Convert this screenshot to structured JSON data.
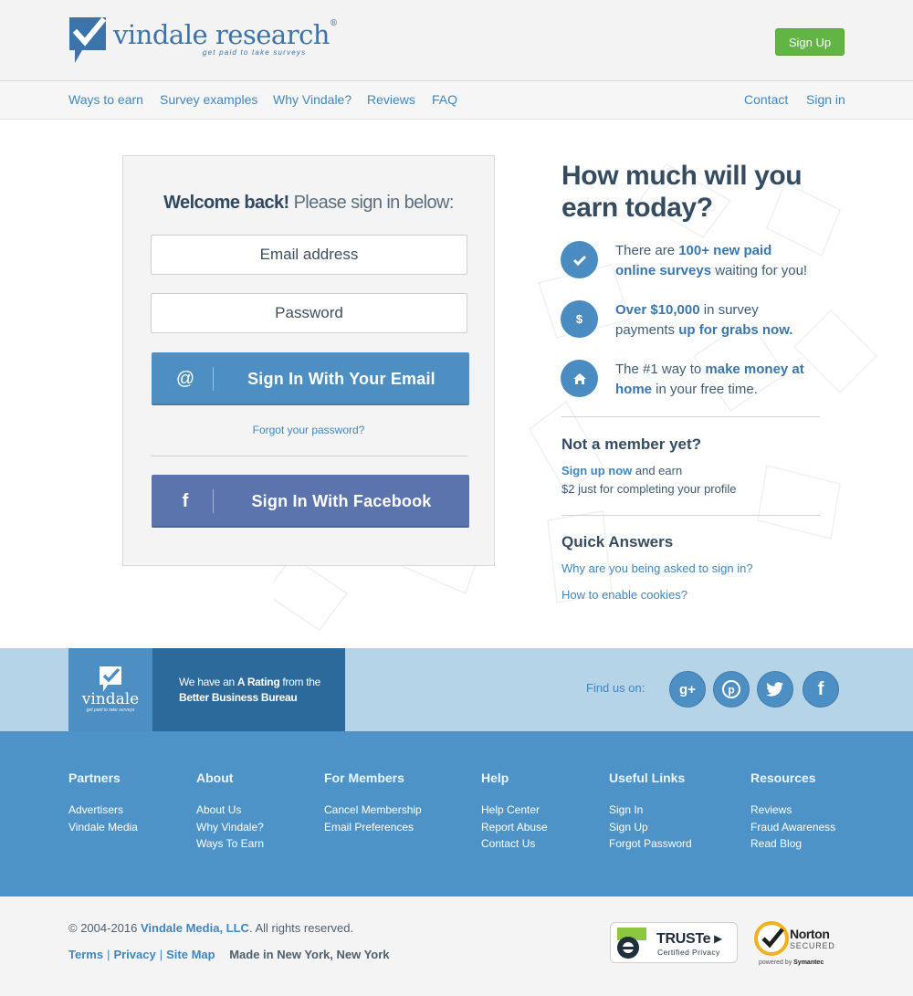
{
  "brand": {
    "name": "vindale research",
    "trademark": "®",
    "tagline": "get paid to take surveys",
    "short_name": "vindale"
  },
  "header": {
    "signup_label": "Sign Up"
  },
  "nav": {
    "left": [
      "Ways to earn",
      "Survey examples",
      "Why Vindale?",
      "Reviews",
      "FAQ"
    ],
    "right": [
      "Contact",
      "Sign in"
    ]
  },
  "signin": {
    "welcome_bold": "Welcome back!",
    "welcome_rest": "Please sign in below:",
    "email_placeholder": "Email address",
    "password_placeholder": "Password",
    "email_button": "Sign In With Your Email",
    "email_icon": "@",
    "forgot": "Forgot your password?",
    "facebook_button": "Sign In With Facebook",
    "facebook_icon": "f"
  },
  "promo": {
    "headline_line1": "How much will you",
    "headline_line2": "earn today?",
    "features": [
      {
        "icon": "check-icon",
        "pre": "There are ",
        "bold1": "100+ new paid",
        "bold2": "online surveys",
        "post": " waiting for you!"
      },
      {
        "icon": "dollar-icon",
        "bold1": "Over $10,000",
        "mid": " in survey",
        "pre2": "payments ",
        "bold2": "up for grabs now."
      },
      {
        "icon": "home-icon",
        "pre": "The #1 way to ",
        "bold1": "make money at",
        "bold2": "home",
        "post": " in your free time."
      }
    ],
    "member_heading": "Not a member yet?",
    "member_link": "Sign up now",
    "member_text1": " and earn",
    "member_text2": "$2 just for completing your profile",
    "qa_heading": "Quick Answers",
    "qa_links": [
      "Why are you being asked to sign in?",
      "How to enable cookies?"
    ]
  },
  "band": {
    "rating_pre": "We have an ",
    "rating_bold": "A Rating",
    "rating_post": " from the",
    "rating_line2": "Better Business Bureau",
    "find_us": "Find us on:",
    "social": [
      {
        "name": "google-plus-icon",
        "glyph": "g+"
      },
      {
        "name": "pinterest-icon",
        "glyph": "p"
      },
      {
        "name": "twitter-icon",
        "glyph": "t"
      },
      {
        "name": "facebook-icon",
        "glyph": "f"
      }
    ]
  },
  "footer": {
    "columns": [
      {
        "heading": "Partners",
        "links": [
          "Advertisers",
          "Vindale Media"
        ]
      },
      {
        "heading": "About",
        "links": [
          "About Us",
          "Why Vindale?",
          "Ways To Earn"
        ]
      },
      {
        "heading": "For Members",
        "links": [
          "Cancel Membership",
          "Email Preferences"
        ]
      },
      {
        "heading": "Help",
        "links": [
          "Help Center",
          "Report Abuse",
          "Contact Us"
        ]
      },
      {
        "heading": "Useful Links",
        "links": [
          "Sign In",
          "Sign Up",
          "Forgot Password"
        ]
      },
      {
        "heading": "Resources",
        "links": [
          "Reviews",
          "Fraud Awareness",
          "Read Blog"
        ]
      }
    ]
  },
  "bottom": {
    "copyright_pre": "© 2004-2016 ",
    "company": "Vindale Media, LLC",
    "copyright_post": ". All rights reserved.",
    "links": [
      "Terms",
      "Privacy",
      "Site Map"
    ],
    "made_in": "Made in New York, New York",
    "truste_name": "TRUSTe",
    "truste_sub": "Certified Privacy",
    "norton_name": "Norton",
    "norton_sub": "SECURED",
    "norton_powered_pre": "powered by ",
    "norton_powered_brand": "Symantec"
  },
  "colors": {
    "primary": "#4e8fc3",
    "link": "#3f86c1",
    "signup_green": "#62b445",
    "facebook": "#5b74ad",
    "heading": "#354b5f",
    "band_light": "#b5d4e8",
    "band_dark": "#2c6a9b",
    "footer": "#4e93c8"
  }
}
